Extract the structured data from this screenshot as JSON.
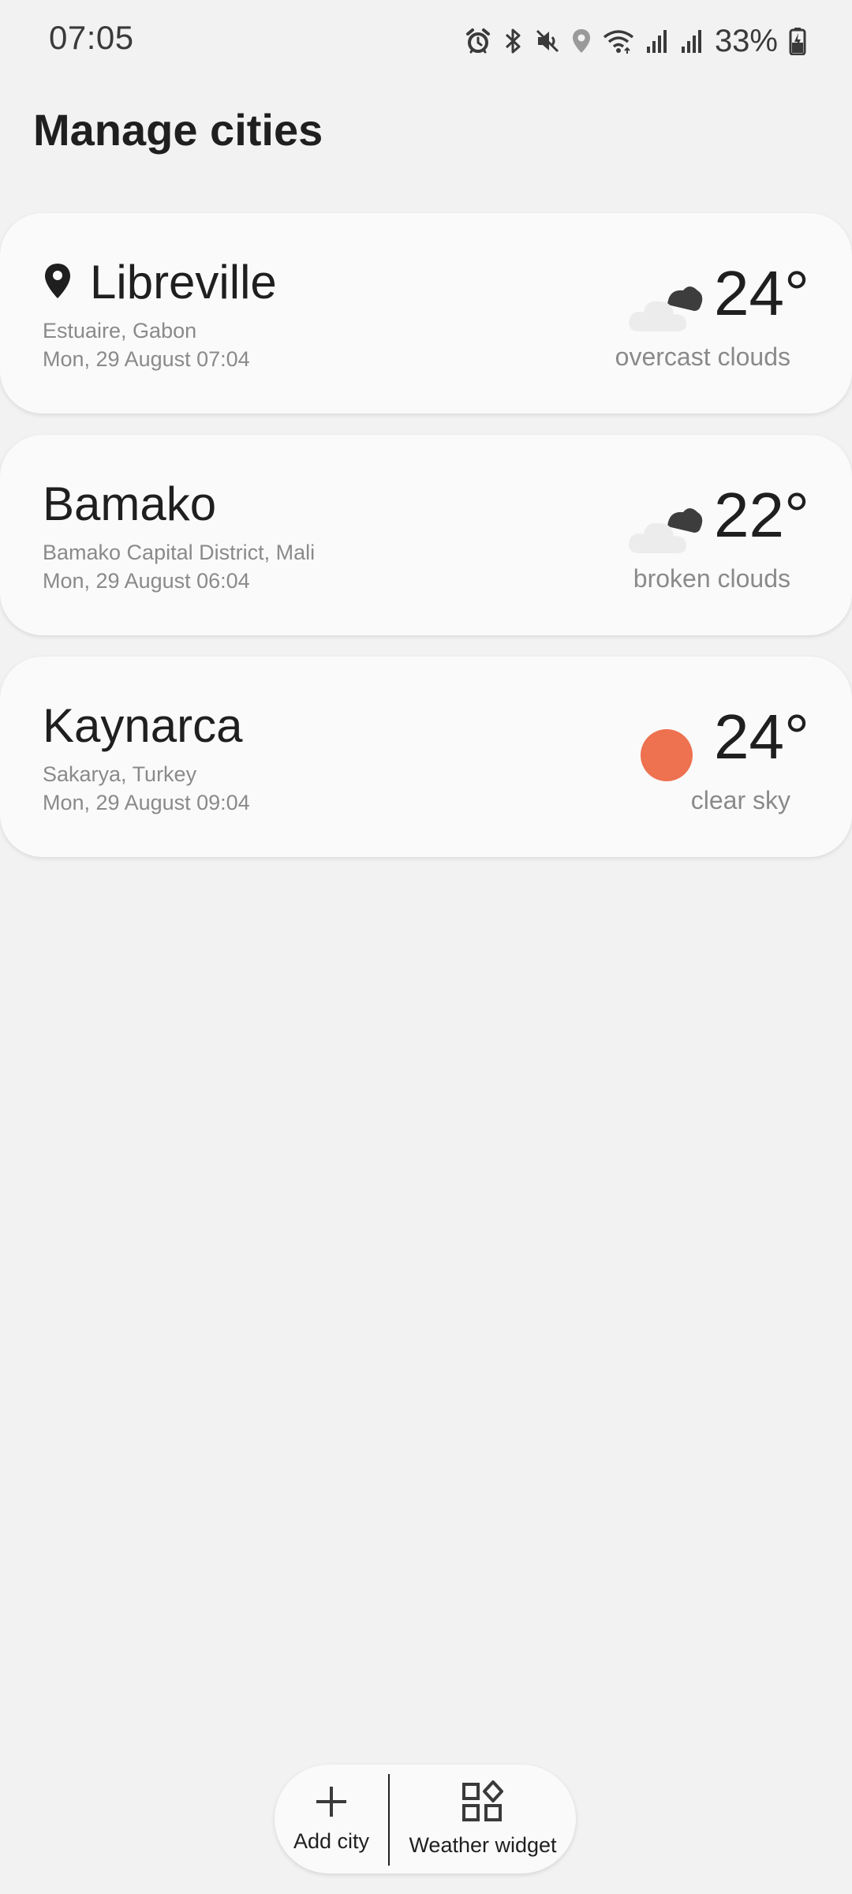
{
  "status_bar": {
    "time": "07:05",
    "battery": "33%",
    "icons": [
      "alarm-icon",
      "bluetooth-icon",
      "mute-icon",
      "location-icon",
      "wifi-icon",
      "signal-icon",
      "signal-icon",
      "battery-charging-icon"
    ]
  },
  "page_title": "Manage cities",
  "cities": [
    {
      "name": "Libreville",
      "is_current_location": true,
      "region": "Estuaire, Gabon",
      "datetime": "Mon, 29 August 07:04",
      "temperature": "24°",
      "condition": "overcast clouds",
      "icon": "cloudy-icon"
    },
    {
      "name": "Bamako",
      "is_current_location": false,
      "region": "Bamako Capital District, Mali",
      "datetime": "Mon, 29 August 06:04",
      "temperature": "22°",
      "condition": "broken clouds",
      "icon": "cloudy-icon"
    },
    {
      "name": "Kaynarca",
      "is_current_location": false,
      "region": "Sakarya, Turkey",
      "datetime": "Mon, 29 August 09:04",
      "temperature": "24°",
      "condition": "clear sky",
      "icon": "sun-icon"
    }
  ],
  "bottom_actions": {
    "add_city": "Add city",
    "weather_widget": "Weather widget"
  },
  "colors": {
    "background": "#f2f2f2",
    "card": "#fafafa",
    "sun": "#ee7150",
    "secondary_text": "#8a8a8a"
  }
}
